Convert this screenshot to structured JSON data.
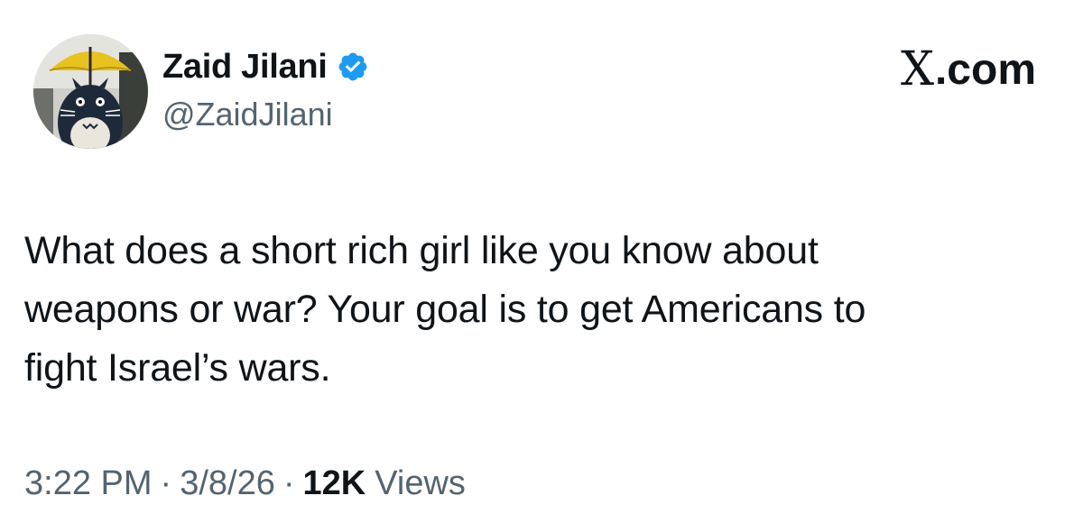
{
  "author": {
    "name": "Zaid Jilani",
    "handle": "@ZaidJilani",
    "verified": true,
    "verified_color": "#1d9bf0"
  },
  "site": {
    "x_letter": "X",
    "suffix": ".com"
  },
  "tweet": {
    "text": "What does a short rich girl like you know about\nweapons or war? Your goal is to get Americans to\nfight Israel’s wars."
  },
  "meta": {
    "time": "3:22 PM",
    "separator": "·",
    "date": "3/8/26",
    "views_count": "12K",
    "views_label": "Views"
  },
  "colors": {
    "text_primary": "#0f1419",
    "text_secondary": "#536471",
    "background": "#ffffff"
  }
}
